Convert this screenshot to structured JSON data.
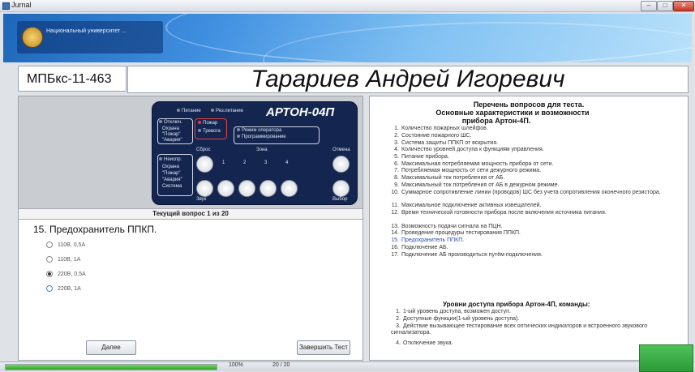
{
  "window": {
    "title": "Jurnal"
  },
  "banner": {
    "logo_text": "Национальный университет ..."
  },
  "header": {
    "group": "МПБкс-11-463",
    "student": "Тарариев Андрей Игоревич"
  },
  "device": {
    "model": "АРТОН-04П",
    "power_label": "Питание",
    "reserve_label": "Рез.питание",
    "disable_label": "Отключ.",
    "disable_items": [
      "Охрана",
      "\"Пожар\"",
      "\"Авария\""
    ],
    "fire_label": "Пожар",
    "alarm_label": "Тревога",
    "mode_items": [
      "Режим оператора",
      "Программирование"
    ],
    "reset_label": "Сброс",
    "zone_label": "Зона",
    "cancel_label": "Отмена",
    "fault_label": "Неиспр.",
    "fault_items": [
      "Охрана",
      "\"Пожар\"",
      "\"Авария\"",
      "Система"
    ],
    "sound_label": "Звук",
    "select_label": "Выбор",
    "zone_keys": [
      "1",
      "2",
      "3",
      "4"
    ]
  },
  "test": {
    "progress_text": "Текущий вопрос 1   из 20",
    "question": "15. Предохранитель ППКП.",
    "options": [
      "110В, 0,5А",
      "110В, 1А",
      "220В, 0,5А",
      "220В, 1А"
    ],
    "selected_index": 2,
    "next_label": "Далее",
    "finish_label": "Завершить Тест"
  },
  "question_list": {
    "heading1": "Перечень вопросов для теста.",
    "heading2": "Основные характеристики и возможности",
    "heading3": "прибора Артон-4П.",
    "items": [
      "Количество пожарных шлейфов.",
      "Состояние пожарного ШС.",
      "Система защиты ППКП от вскрытия.",
      "Количество уровней доступа к функциям управления.",
      "Питание прибора.",
      "Максимальная потребляемая мощность прибора от сети.",
      "Потребляемая мощность от сети дежурного режима.",
      "Максимальный ток потребления от АБ.",
      "Максимальный ток потребления от АБ в дежурном режиме.",
      "Суммарное сопротивление линии (проводов) ШС без учета сопротивления оконечного резистора.",
      "Максимальное подключение активных извещателей.",
      "Время технической готовности прибора после включения источника питания.",
      "Возможность подачи сигнала на ПЦН.",
      "Проведение процедуры тестирования ППКП.",
      "Предохранитель ППКП.",
      "Подключение АБ.",
      "Подключение АБ производиться путём подключения."
    ],
    "active_index": 14,
    "levels_heading": "Уровни доступа прибора Артон-4П, команды:",
    "levels": [
      "1-ый уровень доступа, возможен доступ.",
      "Доступные функции(1-ый уровень доступа).",
      "Действие вызывающее тестирование всех оптических индикаторов и встроенного звукового сигнализатора.",
      "Отключение звука."
    ]
  },
  "status": {
    "progress_fraction": 1.0,
    "percent_text": "100%",
    "counter_text": "20 / 20"
  },
  "colors": {
    "banner": "#2f7fd4",
    "active_question": "#2b4ab5",
    "device_panel": "#14254f"
  }
}
